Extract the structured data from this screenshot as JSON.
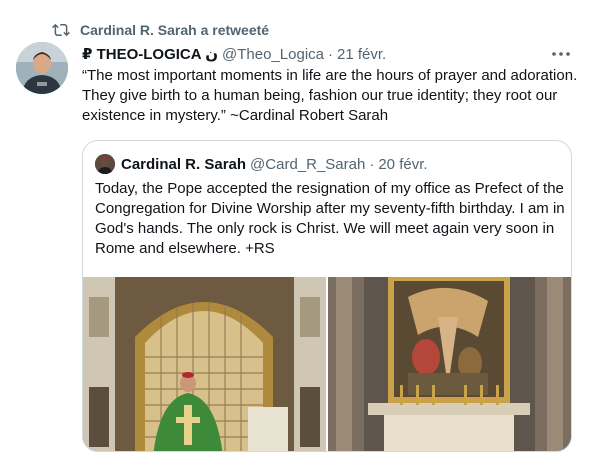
{
  "retweet": {
    "icon": "retweet-icon",
    "label": "Cardinal R. Sarah a retweeté"
  },
  "tweet": {
    "name": "₽ THEO-LOGICA ن",
    "handle": "@Theo_Logica",
    "separator": "·",
    "date": "21 févr.",
    "text": "“The most important moments in life are the hours of prayer and adoration. They give birth to a human being, fashion our true identity; they root our existence in mystery.” ~Cardinal Robert Sarah",
    "more_icon": "more-icon"
  },
  "quote": {
    "name": "Cardinal R. Sarah",
    "handle": "@Card_R_Sarah",
    "separator": "·",
    "date": "20 févr.",
    "text": "Today, the Pope accepted the resignation of my office as Prefect of the Congregation for Divine Worship after my seventy-fifth birthday. I am in God's hands. The only rock is Christ. We will meet again very soon in Rome and elsewhere. +RS"
  },
  "colors": {
    "text_primary": "#0f1419",
    "text_secondary": "#536471",
    "border": "#cfd9de",
    "vestment_green": "#3f8a3a",
    "gold": "#c9a24a"
  }
}
